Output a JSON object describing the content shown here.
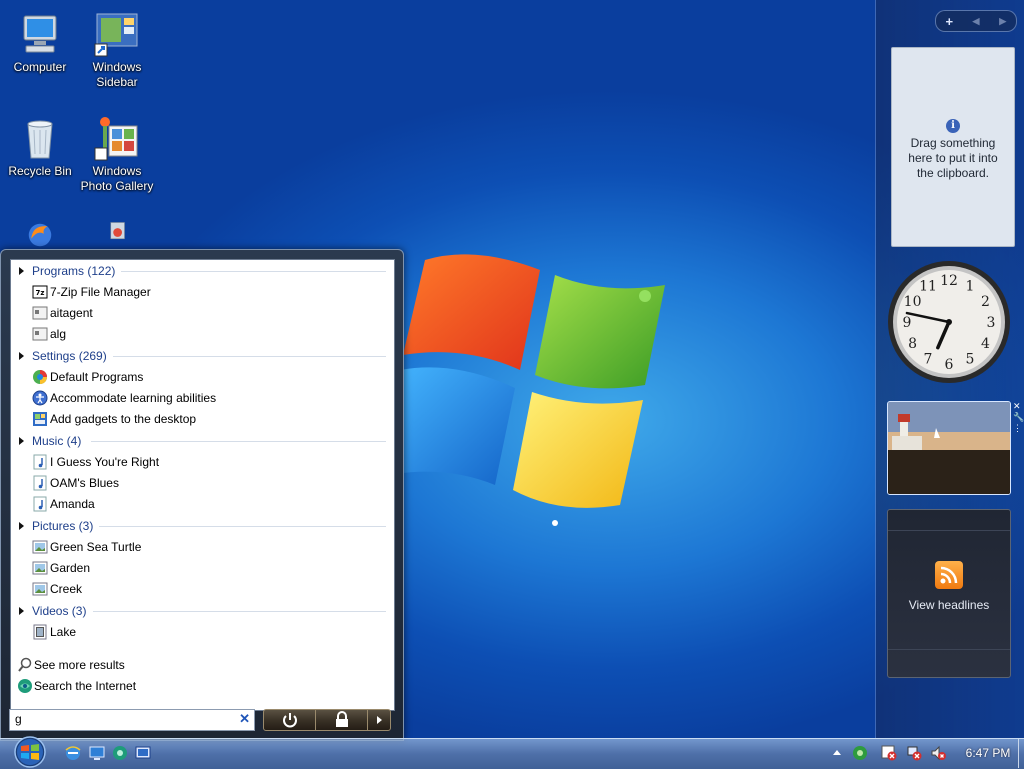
{
  "desktop_icons": [
    {
      "label": "Computer",
      "icon": "computer-icon"
    },
    {
      "label": "Windows Sidebar",
      "icon": "sidebar-icon"
    },
    {
      "label": "Recycle Bin",
      "icon": "recycle-bin-icon"
    },
    {
      "label": "Windows Photo Gallery",
      "icon": "photo-gallery-icon"
    }
  ],
  "sidebar": {
    "add_label": "+",
    "clipboard_message": "Drag something here to put it into the clipboard.",
    "clock": {
      "hour": 6,
      "minute": 47
    },
    "feed_label": "View headlines"
  },
  "start_menu": {
    "groups": [
      {
        "header": "Programs (122)",
        "items": [
          {
            "label": "7-Zip File Manager",
            "icon": "7zip-icon"
          },
          {
            "label": "aitagent",
            "icon": "app-icon"
          },
          {
            "label": "alg",
            "icon": "app-icon"
          }
        ]
      },
      {
        "header": "Settings (269)",
        "items": [
          {
            "label": "Default Programs",
            "icon": "default-programs-icon"
          },
          {
            "label": "Accommodate learning abilities",
            "icon": "ease-of-access-icon"
          },
          {
            "label": "Add gadgets to the desktop",
            "icon": "gadgets-icon"
          }
        ]
      },
      {
        "header": "Music (4)",
        "items": [
          {
            "label": "I Guess You're Right",
            "icon": "music-file-icon"
          },
          {
            "label": "OAM's Blues",
            "icon": "music-file-icon"
          },
          {
            "label": "Amanda",
            "icon": "music-file-icon"
          }
        ]
      },
      {
        "header": "Pictures (3)",
        "items": [
          {
            "label": "Green Sea Turtle",
            "icon": "picture-file-icon"
          },
          {
            "label": "Garden",
            "icon": "picture-file-icon"
          },
          {
            "label": "Creek",
            "icon": "picture-file-icon"
          }
        ]
      },
      {
        "header": "Videos (3)",
        "items": [
          {
            "label": "Lake",
            "icon": "video-file-icon"
          }
        ]
      }
    ],
    "see_more": "See more results",
    "search_internet": "Search the Internet",
    "search_value": "g"
  },
  "taskbar": {
    "time": "6:47 PM"
  }
}
